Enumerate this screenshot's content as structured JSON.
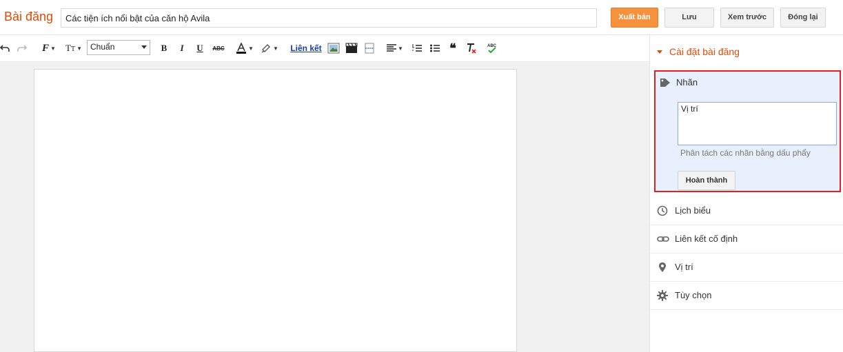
{
  "header": {
    "page_title": "Bài đăng",
    "post_title_value": "Các tiện ích nổi bật của căn hộ Avila",
    "publish_label": "Xuất bản",
    "save_label": "Lưu",
    "preview_label": "Xem trước",
    "close_label": "Đóng lại"
  },
  "toolbar": {
    "paragraph_format": "Chuẩn",
    "link_label": "Liên kết"
  },
  "sidebar": {
    "header": "Cài đặt bài đăng",
    "labels": {
      "title": "Nhãn",
      "value": "Vị trí",
      "hint": "Phân tách các nhãn bằng dấu phẩy",
      "done_label": "Hoàn thành"
    },
    "items": [
      {
        "label": "Lịch biểu",
        "icon": "clock-icon"
      },
      {
        "label": "Liên kết cố định",
        "icon": "link-icon"
      },
      {
        "label": "Vị trí",
        "icon": "location-pin-icon"
      },
      {
        "label": "Tùy chọn",
        "icon": "gear-icon"
      }
    ]
  },
  "colors": {
    "accent": "#dd4b08",
    "publish_button": "#f6923d",
    "highlight_border": "#e0201f",
    "panel_bg": "#e8f0fd"
  }
}
